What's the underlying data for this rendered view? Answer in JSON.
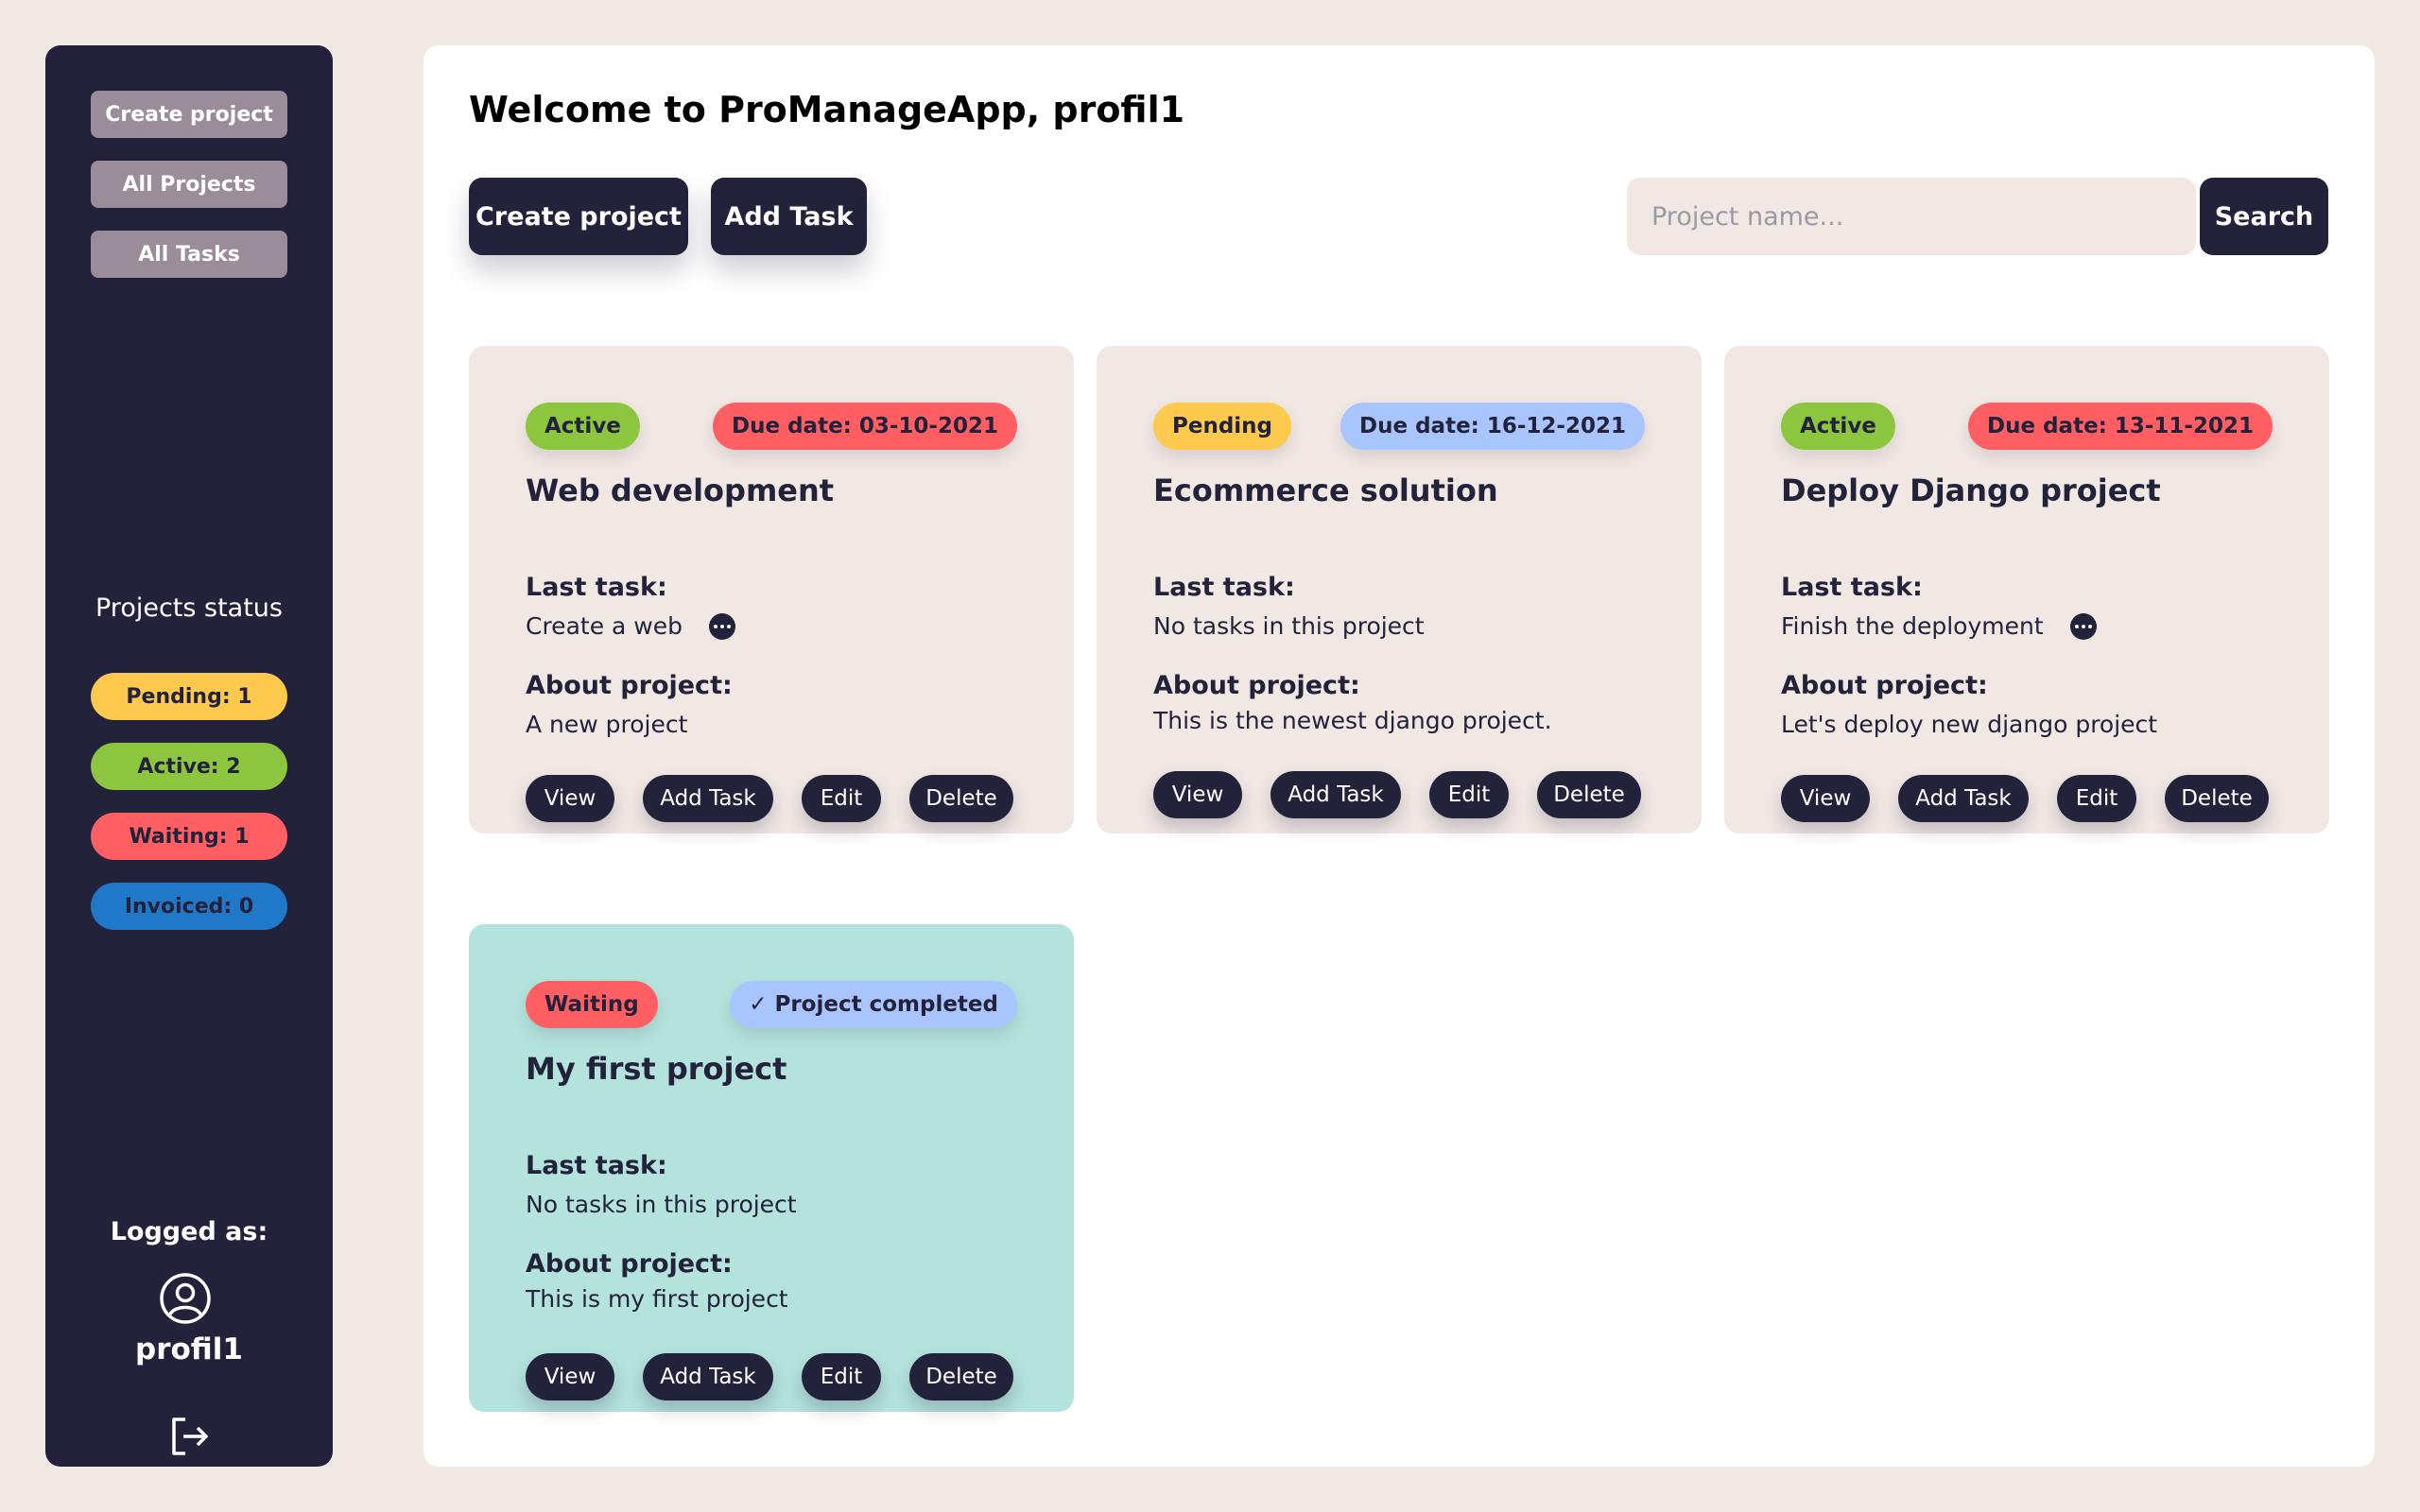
{
  "sidebar": {
    "nav": [
      "Create project",
      "All Projects",
      "All Tasks"
    ],
    "status_title": "Projects status",
    "statuses": [
      {
        "label": "Pending: 1",
        "bg": "#ffc94d",
        "color": "#22223b"
      },
      {
        "label": "Active: 2",
        "bg": "#8cc63f",
        "color": "#22223b"
      },
      {
        "label": "Waiting: 1",
        "bg": "#ff5e63",
        "color": "#22223b"
      },
      {
        "label": "Invoiced: 0",
        "bg": "#1f78c8",
        "color": "#22223b"
      }
    ],
    "logged_as": "Logged as:",
    "username": "profil1",
    "icons": {
      "user": "user-circle-icon",
      "logout": "logout-icon"
    }
  },
  "header": {
    "welcome": "Welcome to ProManageApp, profil1",
    "create_project_label": "Create project",
    "add_task_label": "Add Task",
    "search_placeholder": "Project name...",
    "search_value": "",
    "search_label": "Search"
  },
  "labels": {
    "last_task": "Last task:",
    "about": "About project:",
    "view": "View",
    "add_task": "Add Task",
    "edit": "Edit",
    "delete": "Delete"
  },
  "colors": {
    "dark": "#22223b",
    "sidebar_btn": "#9a8c98",
    "card_bg": "#f1e8e4",
    "card_done_bg": "#b4e2dc",
    "active": "#8cc63f",
    "pending": "#ffc94d",
    "waiting": "#ff5e63",
    "due_red": "#ff5e63",
    "due_blue": "#a9c5ff"
  },
  "projects": [
    {
      "status": "Active",
      "status_color": "#8cc63f",
      "right_badge": "Due date: 03-10-2021",
      "right_color": "#ff5e63",
      "title": "Web development",
      "last_task": "Create a web",
      "has_task_menu": true,
      "about": "A new project",
      "completed": false
    },
    {
      "status": "Pending",
      "status_color": "#ffc94d",
      "right_badge": "Due date: 16-12-2021",
      "right_color": "#a9c5ff",
      "title": "Ecommerce solution",
      "last_task": "No tasks in this project",
      "has_task_menu": false,
      "about": "This is the newest django project.",
      "completed": false
    },
    {
      "status": "Active",
      "status_color": "#8cc63f",
      "right_badge": "Due date: 13-11-2021",
      "right_color": "#ff5e63",
      "title": "Deploy Django project",
      "last_task": "Finish the deployment",
      "has_task_menu": true,
      "about": "Let's deploy new django project",
      "completed": false
    },
    {
      "status": "Waiting",
      "status_color": "#ff5e63",
      "right_badge": "✓ Project completed",
      "right_color": "#a9c5ff",
      "title": "My first project",
      "last_task": "No tasks in this project",
      "has_task_menu": false,
      "about": "This is my first project",
      "completed": true
    }
  ]
}
